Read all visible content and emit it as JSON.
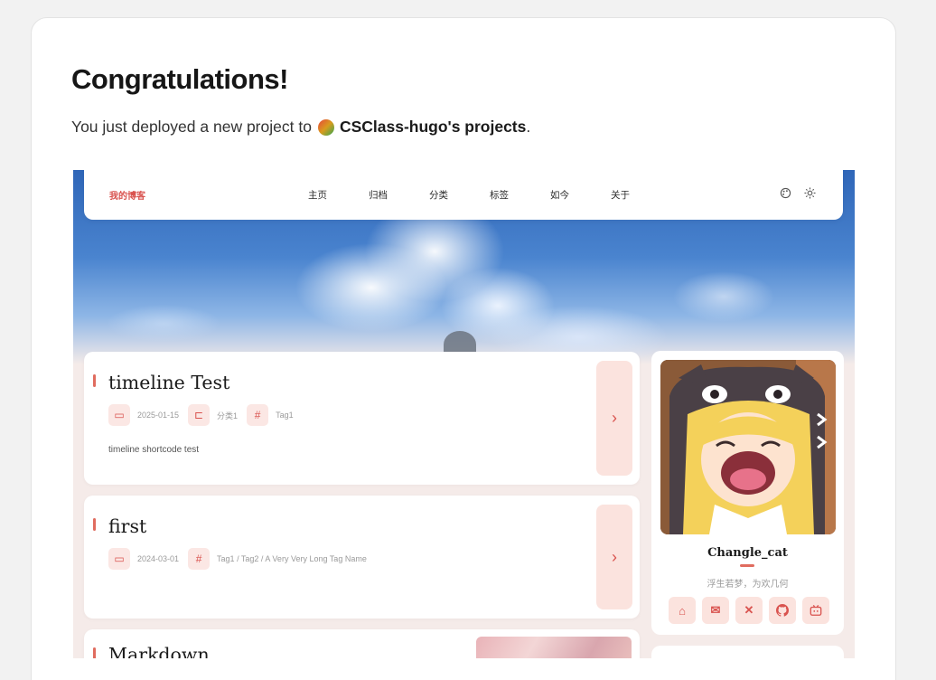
{
  "heading": "Congratulations!",
  "subline": {
    "prefix": "You just deployed a new project to",
    "team": "CSClass-hugo's projects",
    "suffix": "."
  },
  "preview": {
    "nav": {
      "brand": "我的博客",
      "links": [
        "主页",
        "归档",
        "分类",
        "标签",
        "如今",
        "关于"
      ],
      "icons": [
        "palette-icon",
        "sun-icon"
      ]
    },
    "posts": [
      {
        "title": "timeline Test",
        "date": "2025-01-15",
        "category": "分类1",
        "tags": "Tag1",
        "excerpt": "timeline shortcode test"
      },
      {
        "title": "first",
        "date": "2024-03-01",
        "tags": "Tag1 / Tag2 / A Very Very Long Tag Name"
      },
      {
        "title": "Markdown"
      }
    ],
    "profile": {
      "name": "Changle_cat",
      "motto": "浮生若梦，为欢几何",
      "socials": [
        "home-icon",
        "mail-icon",
        "x-icon",
        "github-icon",
        "bilibili-icon"
      ]
    }
  },
  "colors": {
    "accent": "#d9534f",
    "chip_bg": "#fbe7e4",
    "page_bg": "#f2f2f2"
  }
}
